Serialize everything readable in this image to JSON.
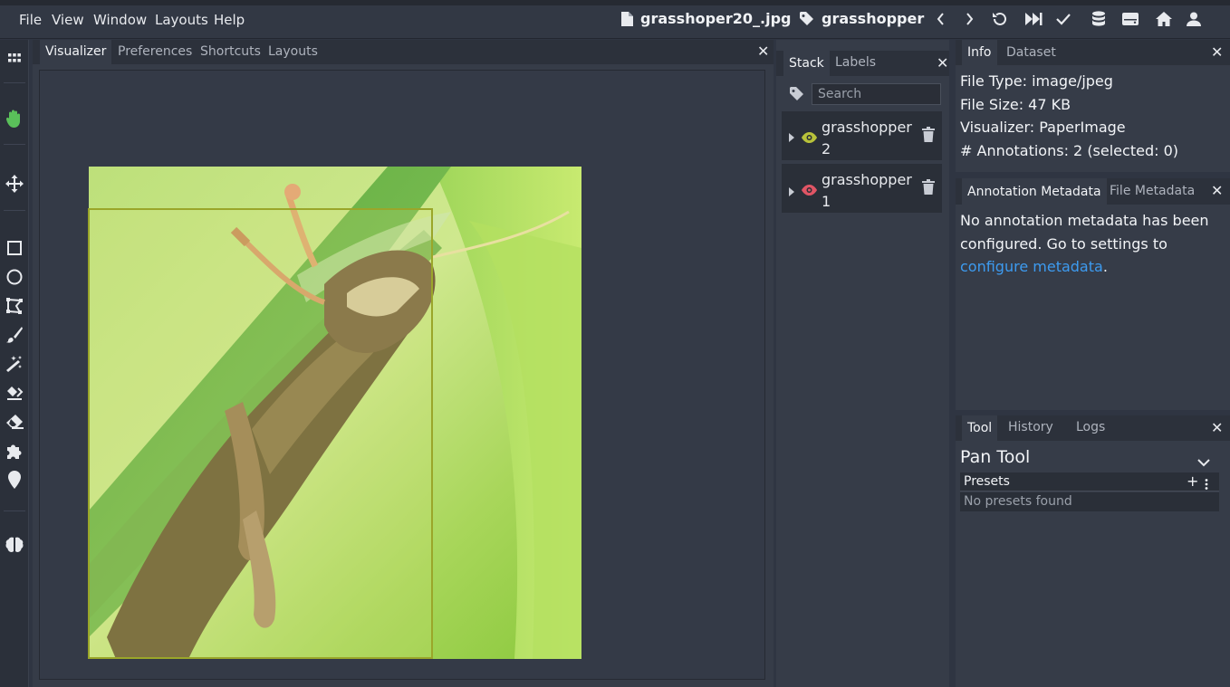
{
  "menubar": {
    "items": [
      "File",
      "View",
      "Window",
      "Layouts",
      "Help"
    ],
    "file_name": "grasshoper20_.jpg",
    "label_name": "grasshopper"
  },
  "icons": {
    "toolbar_right": [
      "chevron-left-icon",
      "chevron-right-icon",
      "undo-icon",
      "fast-forward-icon",
      "check-icon",
      "database-icon",
      "server-icon",
      "home-icon",
      "user-icon"
    ],
    "left_tools": [
      "apps-icon",
      "hand-icon",
      "move-icon",
      "rectangle-icon",
      "circle-icon",
      "polygon-icon",
      "brush-icon",
      "magic-wand-icon",
      "eraser-fill-icon",
      "eraser-icon",
      "puzzle-icon",
      "pin-icon",
      "brain-icon"
    ]
  },
  "visualizer_panel": {
    "tabs": [
      "Visualizer",
      "Preferences",
      "Shortcuts",
      "Layouts"
    ],
    "active_tab": "Visualizer"
  },
  "stack_panel": {
    "tabs": [
      "Stack",
      "Labels"
    ],
    "search_placeholder": "Search",
    "items": [
      {
        "name": "grasshopper",
        "index": "2",
        "eye_color": "#b8c23a"
      },
      {
        "name": "grasshopper",
        "index": "1",
        "eye_color": "#e05565"
      }
    ]
  },
  "info_panel": {
    "tabs": [
      "Info",
      "Dataset"
    ],
    "file_type": "File Type: image/jpeg",
    "file_size": "File Size: 47 KB",
    "visualizer": "Visualizer: PaperImage",
    "annotations": "# Annotations: 2 (selected: 0)"
  },
  "metadata_panel": {
    "tabs": [
      "Annotation Metadata",
      "File Metadata"
    ],
    "message": "No annotation metadata has been configured. Go to settings to",
    "link_text": "configure metadata",
    "period": "."
  },
  "tool_panel": {
    "tabs": [
      "Tool",
      "History",
      "Logs"
    ],
    "tool_name": "Pan Tool",
    "presets_label": "Presets",
    "no_presets": "No presets found"
  },
  "colors": {
    "accent_link": "#3d9bf0",
    "annotation_border": "#9aa62a",
    "hand_tool_active": "#5ac05a"
  }
}
